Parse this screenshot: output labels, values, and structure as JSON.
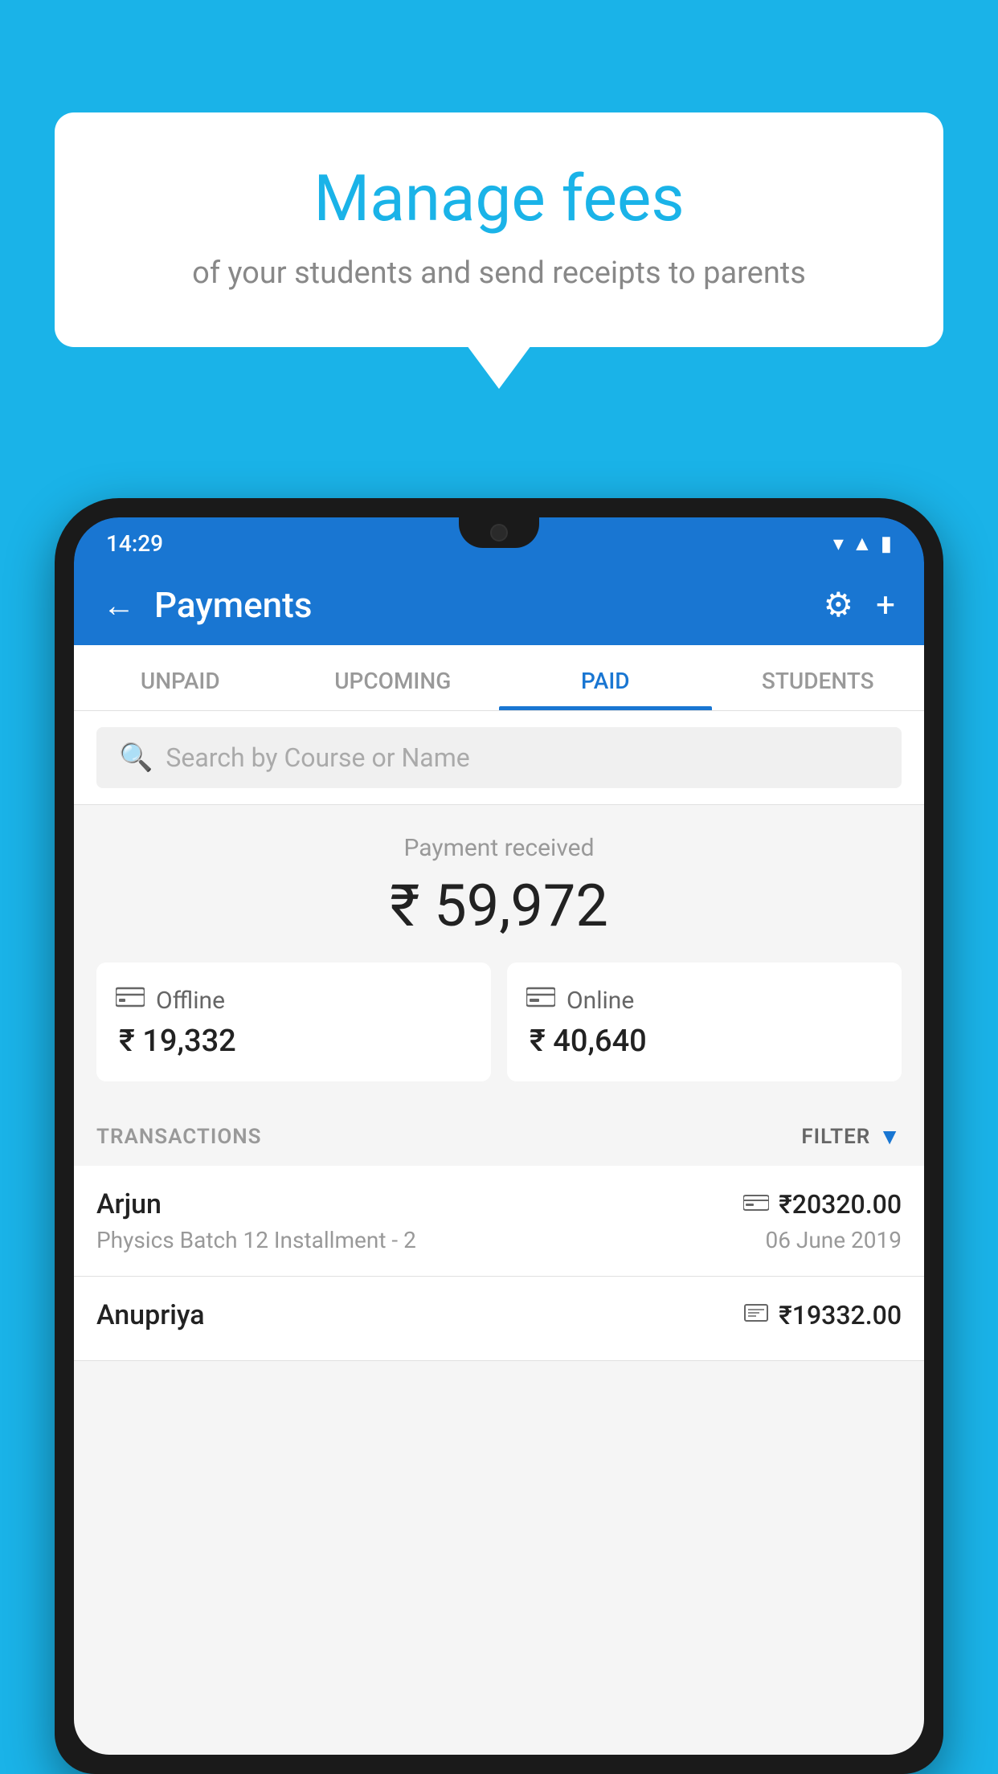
{
  "background_color": "#1ab3e8",
  "speech_bubble": {
    "title": "Manage fees",
    "subtitle": "of your students and send receipts to parents"
  },
  "status_bar": {
    "time": "14:29",
    "wifi": "▼",
    "signal": "▲",
    "battery": "▮"
  },
  "app_bar": {
    "title": "Payments",
    "back_label": "←",
    "gear_label": "⚙",
    "plus_label": "+"
  },
  "tabs": [
    {
      "label": "UNPAID",
      "active": false
    },
    {
      "label": "UPCOMING",
      "active": false
    },
    {
      "label": "PAID",
      "active": true
    },
    {
      "label": "STUDENTS",
      "active": false
    }
  ],
  "search": {
    "placeholder": "Search by Course or Name"
  },
  "payment_summary": {
    "label": "Payment received",
    "total": "₹ 59,972",
    "offline": {
      "icon": "💳",
      "label": "Offline",
      "amount": "₹ 19,332"
    },
    "online": {
      "icon": "💳",
      "label": "Online",
      "amount": "₹ 40,640"
    }
  },
  "transactions": {
    "label": "TRANSACTIONS",
    "filter_label": "FILTER",
    "rows": [
      {
        "name": "Arjun",
        "type_icon": "💳",
        "amount": "₹20320.00",
        "course": "Physics Batch 12 Installment - 2",
        "date": "06 June 2019"
      },
      {
        "name": "Anupriya",
        "type_icon": "💵",
        "amount": "₹19332.00",
        "course": "",
        "date": ""
      }
    ]
  }
}
